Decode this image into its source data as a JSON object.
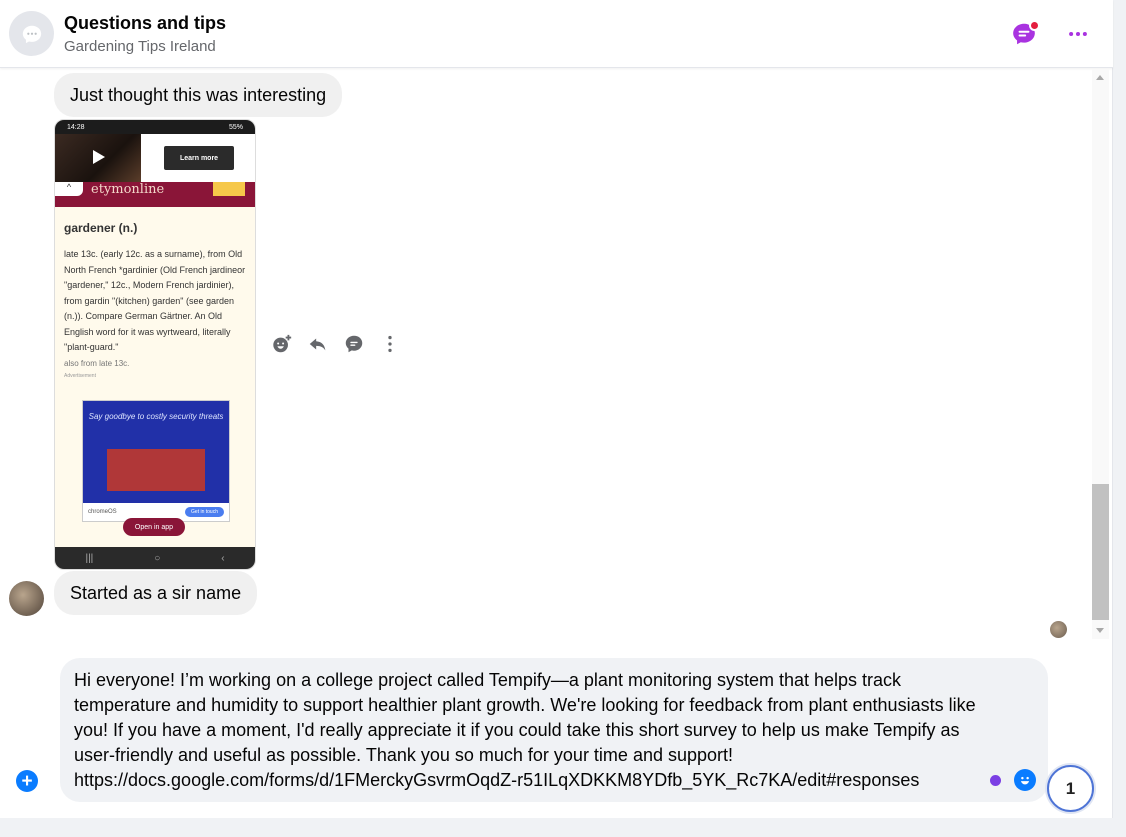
{
  "header": {
    "title": "Questions and tips",
    "subtitle": "Gardening Tips Ireland",
    "accent_color": "#a933e0",
    "icons": [
      "chat-bubble-icon",
      "more-icon"
    ]
  },
  "messages": [
    {
      "text": "Just thought this was interesting"
    },
    {
      "text": "Started as a sir name"
    }
  ],
  "shared_screenshot": {
    "status_time": "14:28",
    "status_battery": "55%",
    "learn_more": "Learn more",
    "site_logo": "etymonline",
    "entry_title": "gardener (n.)",
    "entry_body": "late 13c. (early 12c. as a surname), from Old North French *gardinier (Old French jardineor \"gardener,\" 12c., Modern French jardinier), from gardin \"(kitchen) garden\" (see garden (n.)). Compare German Gärtner. An Old English word for it was wyrtweard, literally \"plant-guard.\"",
    "also_from": "also from late 13c.",
    "ad_label": "Advertisement",
    "ad_headline": "Say goodbye to costly security threats",
    "ad_brand": "chromeOS",
    "ad_button": "Get in touch",
    "open_in_app": "Open in app"
  },
  "hover_actions": [
    "react-icon",
    "reply-icon",
    "comment-icon",
    "more-vertical-icon"
  ],
  "composer": {
    "text": "Hi everyone! I’m working on a college project called Tempify—a plant monitoring system that helps track temperature and humidity to support healthier plant growth. We're looking for feedback from plant enthusiasts like you! If you have a moment, I'd really appreciate it if you could take this short survey to help us make Tempify as user-friendly and useful as possible. Thank you so much for your time and support!\nhttps://docs.google.com/forms/d/1FMerckyGsvrmOqdZ-r51ILqXDKKM8YDfb_5YK_Rc7KA/edit#responses",
    "plus_label": "+",
    "counter": "1"
  }
}
